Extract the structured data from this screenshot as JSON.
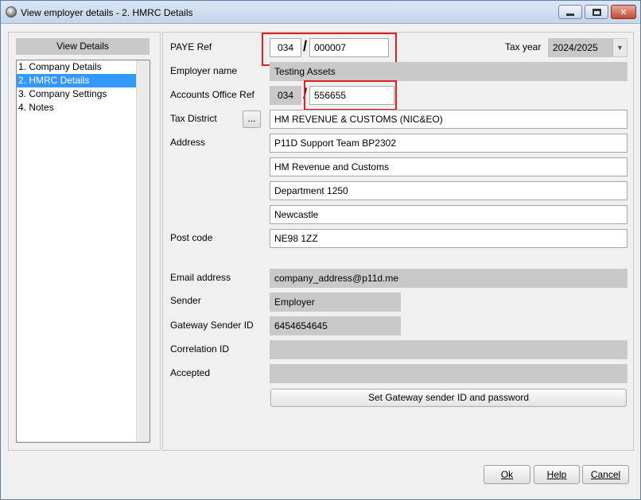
{
  "window": {
    "title": "View employer details - 2. HMRC Details"
  },
  "sidebar": {
    "header": "View Details",
    "items": [
      {
        "label": "1. Company Details",
        "selected": false
      },
      {
        "label": "2. HMRC Details",
        "selected": true
      },
      {
        "label": "3. Company Settings",
        "selected": false
      },
      {
        "label": "4. Notes",
        "selected": false
      }
    ]
  },
  "form": {
    "paye_ref_label": "PAYE Ref",
    "paye_ref_office": "034",
    "paye_ref_sep": "/",
    "paye_ref_number": "000007",
    "tax_year_label": "Tax year",
    "tax_year_value": "2024/2025",
    "employer_name_label": "Employer name",
    "employer_name_value": "Testing Assets",
    "accounts_office_ref_label": "Accounts Office Ref",
    "accounts_office_ref_office": "034",
    "accounts_office_ref_sep": "/",
    "accounts_office_ref_number": "556655",
    "tax_district_label": "Tax District",
    "tax_district_button": "...",
    "tax_district_value": "HM REVENUE & CUSTOMS (NIC&EO)",
    "address_label": "Address",
    "address_lines": [
      "P11D Support Team BP2302",
      "HM Revenue and Customs",
      "Department 1250",
      "Newcastle"
    ],
    "postcode_label": "Post code",
    "postcode_value": "NE98 1ZZ",
    "email_label": "Email address",
    "email_value": "company_address@p11d.me",
    "sender_label": "Sender",
    "sender_value": "Employer",
    "gateway_sender_id_label": "Gateway Sender ID",
    "gateway_sender_id_value": "6454654645",
    "correlation_id_label": "Correlation ID",
    "correlation_id_value": "",
    "accepted_label": "Accepted",
    "accepted_value": "",
    "set_gateway_button": "Set Gateway sender ID and password"
  },
  "footer": {
    "ok_label": "Ok",
    "help_label": "Help",
    "cancel_label": "Cancel"
  },
  "colors": {
    "selection": "#3399ff",
    "highlight_box": "#e02020",
    "readonly_field": "#c9c9c9"
  }
}
